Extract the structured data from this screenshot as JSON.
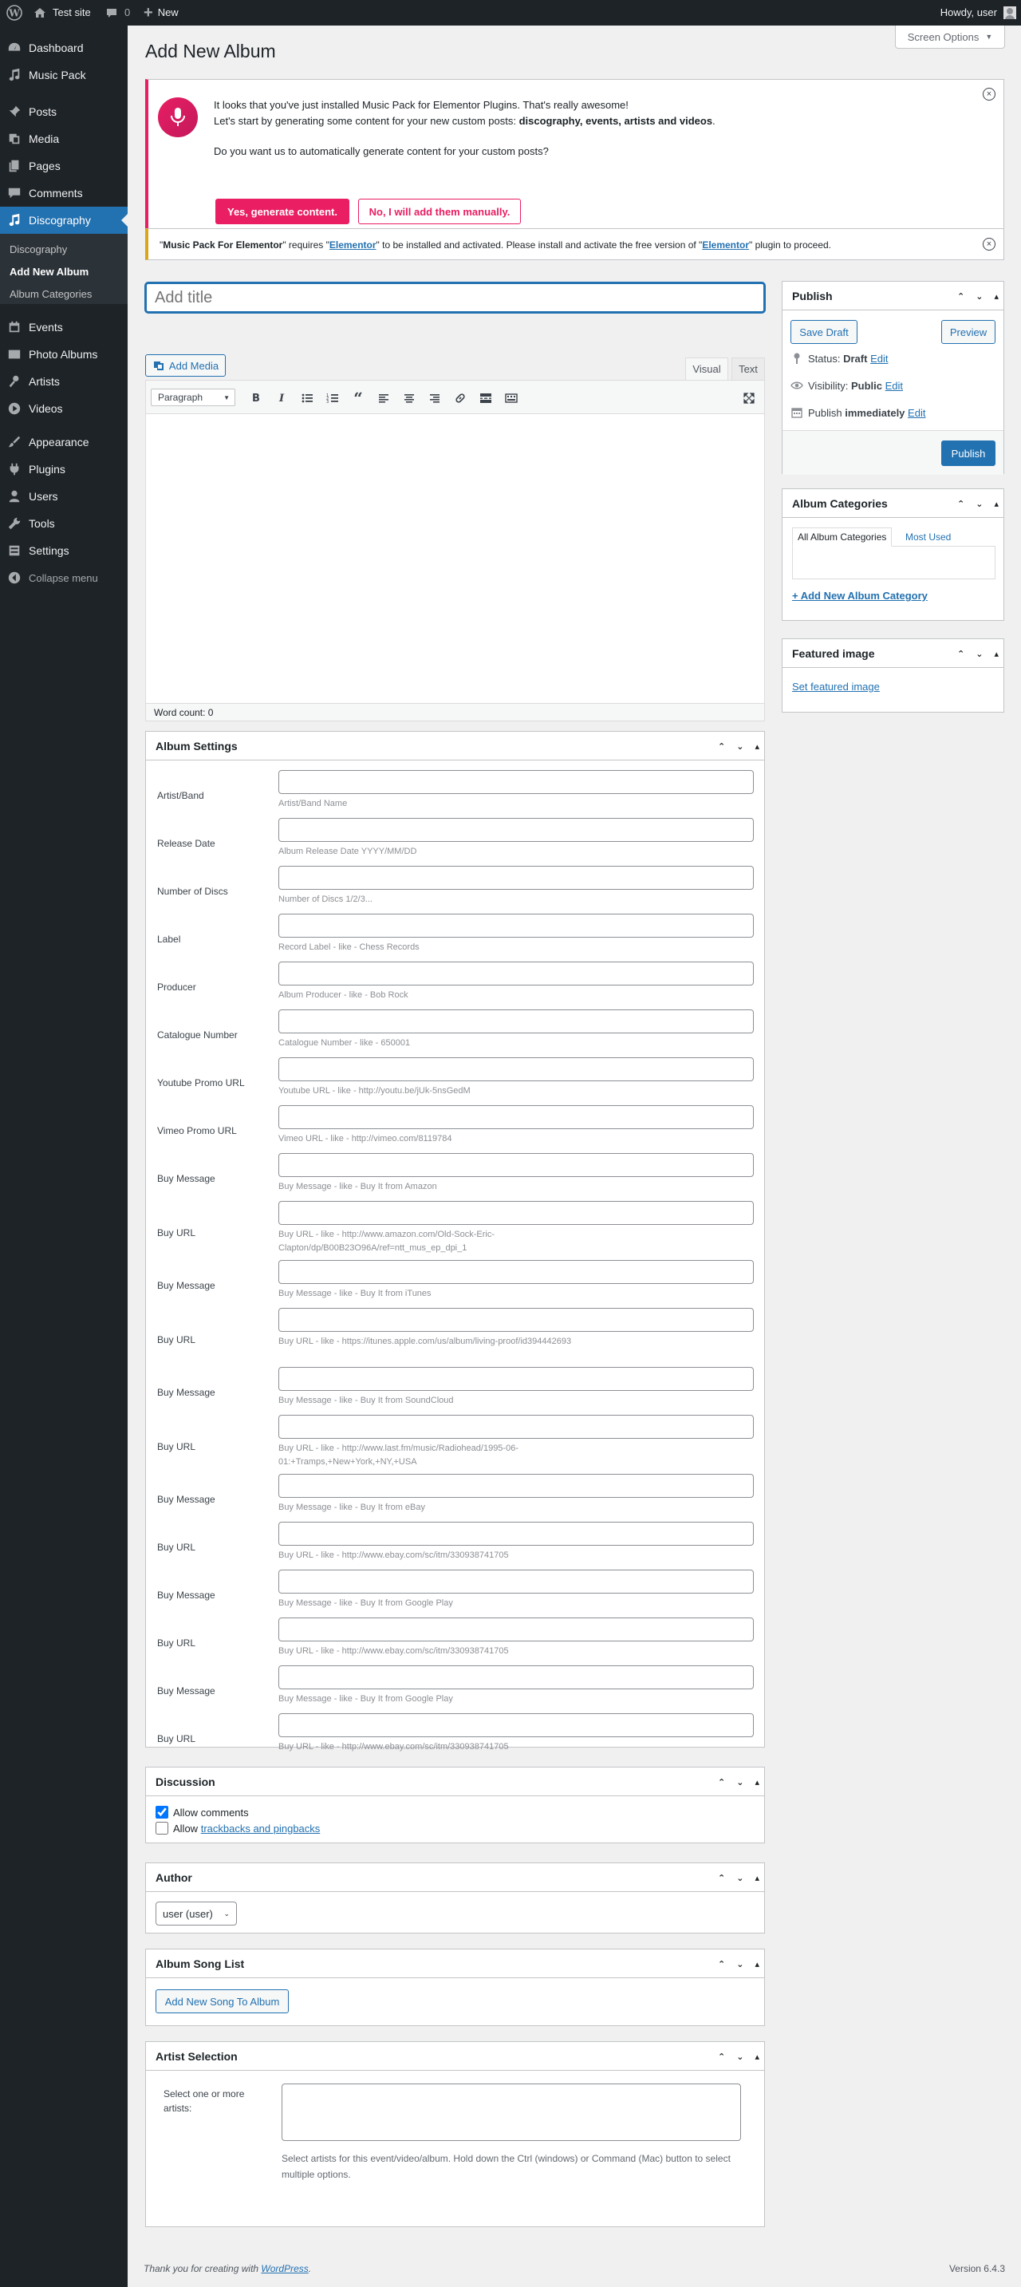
{
  "adminbar": {
    "site_name": "Test site",
    "comments_count": "0",
    "new_label": "New",
    "howdy": "Howdy, user"
  },
  "sidebar": {
    "items": [
      {
        "label": "Dashboard",
        "icon": "dashboard-icon"
      },
      {
        "label": "Music Pack",
        "icon": "music-icon"
      },
      {
        "label": "Posts",
        "icon": "pin-icon"
      },
      {
        "label": "Media",
        "icon": "media-icon"
      },
      {
        "label": "Pages",
        "icon": "pages-icon"
      },
      {
        "label": "Comments",
        "icon": "comments-icon"
      },
      {
        "label": "Discography",
        "icon": "music-icon"
      },
      {
        "label": "Events",
        "icon": "calendar-icon"
      },
      {
        "label": "Photo Albums",
        "icon": "photo-icon"
      },
      {
        "label": "Artists",
        "icon": "artist-icon"
      },
      {
        "label": "Videos",
        "icon": "video-icon"
      },
      {
        "label": "Appearance",
        "icon": "brush-icon"
      },
      {
        "label": "Plugins",
        "icon": "plugin-icon"
      },
      {
        "label": "Users",
        "icon": "users-icon"
      },
      {
        "label": "Tools",
        "icon": "wrench-icon"
      },
      {
        "label": "Settings",
        "icon": "settings-icon"
      },
      {
        "label": "Collapse menu",
        "icon": "collapse-icon"
      }
    ],
    "submenu": [
      "Discography",
      "Add New Album",
      "Album Categories"
    ]
  },
  "screen_options": "Screen Options",
  "page_title": "Add New Album",
  "notice_music": {
    "line1": "It looks that you've just installed Music Pack for Elementor Plugins. That's really awesome!",
    "line2_prefix": "Let's start by generating some content for your new custom posts: ",
    "line2_bold": "discography, events, artists and videos",
    "line2_suffix": ".",
    "question": "Do you want us to automatically generate content for your custom posts?",
    "yes_btn": "Yes, generate content.",
    "no_btn": "No, I will add them manually.",
    "accent": "#e91e63"
  },
  "notice_elementor": {
    "q1": "\"",
    "plugin": "Music Pack For Elementor",
    "requires": "\" requires \"",
    "link1": "Elementor",
    "middle": "\" to be installed and activated. Please install and activate the free version of \"",
    "link2": "Elementor",
    "end": "\" plugin to proceed."
  },
  "title_placeholder": "Add title",
  "editor": {
    "add_media": "Add Media",
    "tab_visual": "Visual",
    "tab_text": "Text",
    "format": "Paragraph",
    "word_count": "Word count: 0"
  },
  "publish": {
    "title": "Publish",
    "save_draft": "Save Draft",
    "preview": "Preview",
    "status_label": "Status: ",
    "status_value": "Draft",
    "visibility_label": "Visibility: ",
    "visibility_value": "Public",
    "publish_label": "Publish ",
    "publish_value": "immediately",
    "edit": "Edit",
    "publish_btn": "Publish"
  },
  "album_categories": {
    "title": "Album Categories",
    "tab_all": "All Album Categories",
    "tab_most": "Most Used",
    "add_new": "+ Add New Album Category"
  },
  "featured_image": {
    "title": "Featured image",
    "link": "Set featured image"
  },
  "album_settings": {
    "title": "Album Settings",
    "fields": [
      {
        "label": "Artist/Band",
        "desc": "Artist/Band Name"
      },
      {
        "label": "Release Date",
        "desc": "Album Release Date YYYY/MM/DD"
      },
      {
        "label": "Number of Discs",
        "desc": "Number of Discs 1/2/3..."
      },
      {
        "label": "Label",
        "desc": "Record Label - like - Chess Records"
      },
      {
        "label": "Producer",
        "desc": "Album Producer - like - Bob Rock"
      },
      {
        "label": "Catalogue Number",
        "desc": "Catalogue Number - like - 650001"
      },
      {
        "label": "Youtube Promo URL",
        "desc": "Youtube URL - like - http://youtu.be/jUk-5nsGedM"
      },
      {
        "label": "Vimeo Promo URL",
        "desc": "Vimeo URL - like - http://vimeo.com/8119784"
      },
      {
        "label": "Buy Message",
        "desc": "Buy Message - like - Buy It from Amazon"
      },
      {
        "label": "Buy URL",
        "desc": "Buy URL - like - http://www.amazon.com/Old-Sock-Eric-Clapton/dp/B00B23O96A/ref=ntt_mus_ep_dpi_1"
      },
      {
        "label": "Buy Message",
        "desc": "Buy Message - like - Buy It from iTunes"
      },
      {
        "label": "Buy URL",
        "desc": "Buy URL - like - https://itunes.apple.com/us/album/living-proof/id394442693"
      },
      {
        "label": "Buy Message",
        "desc": "Buy Message - like - Buy It from SoundCloud"
      },
      {
        "label": "Buy URL",
        "desc": "Buy URL - like - http://www.last.fm/music/Radiohead/1995-06-01:+Tramps,+New+York,+NY,+USA"
      },
      {
        "label": "Buy Message",
        "desc": "Buy Message - like - Buy It from eBay"
      },
      {
        "label": "Buy URL",
        "desc": "Buy URL - like - http://www.ebay.com/sc/itm/330938741705"
      },
      {
        "label": "Buy Message",
        "desc": "Buy Message - like - Buy It from Google Play"
      },
      {
        "label": "Buy URL",
        "desc": "Buy URL - like - http://www.ebay.com/sc/itm/330938741705"
      },
      {
        "label": "Buy Message",
        "desc": "Buy Message - like - Buy It from Google Play"
      },
      {
        "label": "Buy URL",
        "desc": "Buy URL - like - http://www.ebay.com/sc/itm/330938741705"
      }
    ]
  },
  "discussion": {
    "title": "Discussion",
    "allow_comments": "Allow comments",
    "allow_prefix": "Allow ",
    "trackbacks": "trackbacks and pingbacks"
  },
  "author": {
    "title": "Author",
    "selected": "user (user)"
  },
  "song_list": {
    "title": "Album Song List",
    "add_btn": "Add New Song To Album"
  },
  "artist_selection": {
    "title": "Artist Selection",
    "label": "Select one or more artists:",
    "help": "Select artists for this event/video/album. Hold down the Ctrl (windows) or Command (Mac) button to select multiple options."
  },
  "footer": {
    "thanks_prefix": "Thank you for creating with ",
    "wp_link": "WordPress",
    "thanks_suffix": ".",
    "version": "Version 6.4.3"
  }
}
